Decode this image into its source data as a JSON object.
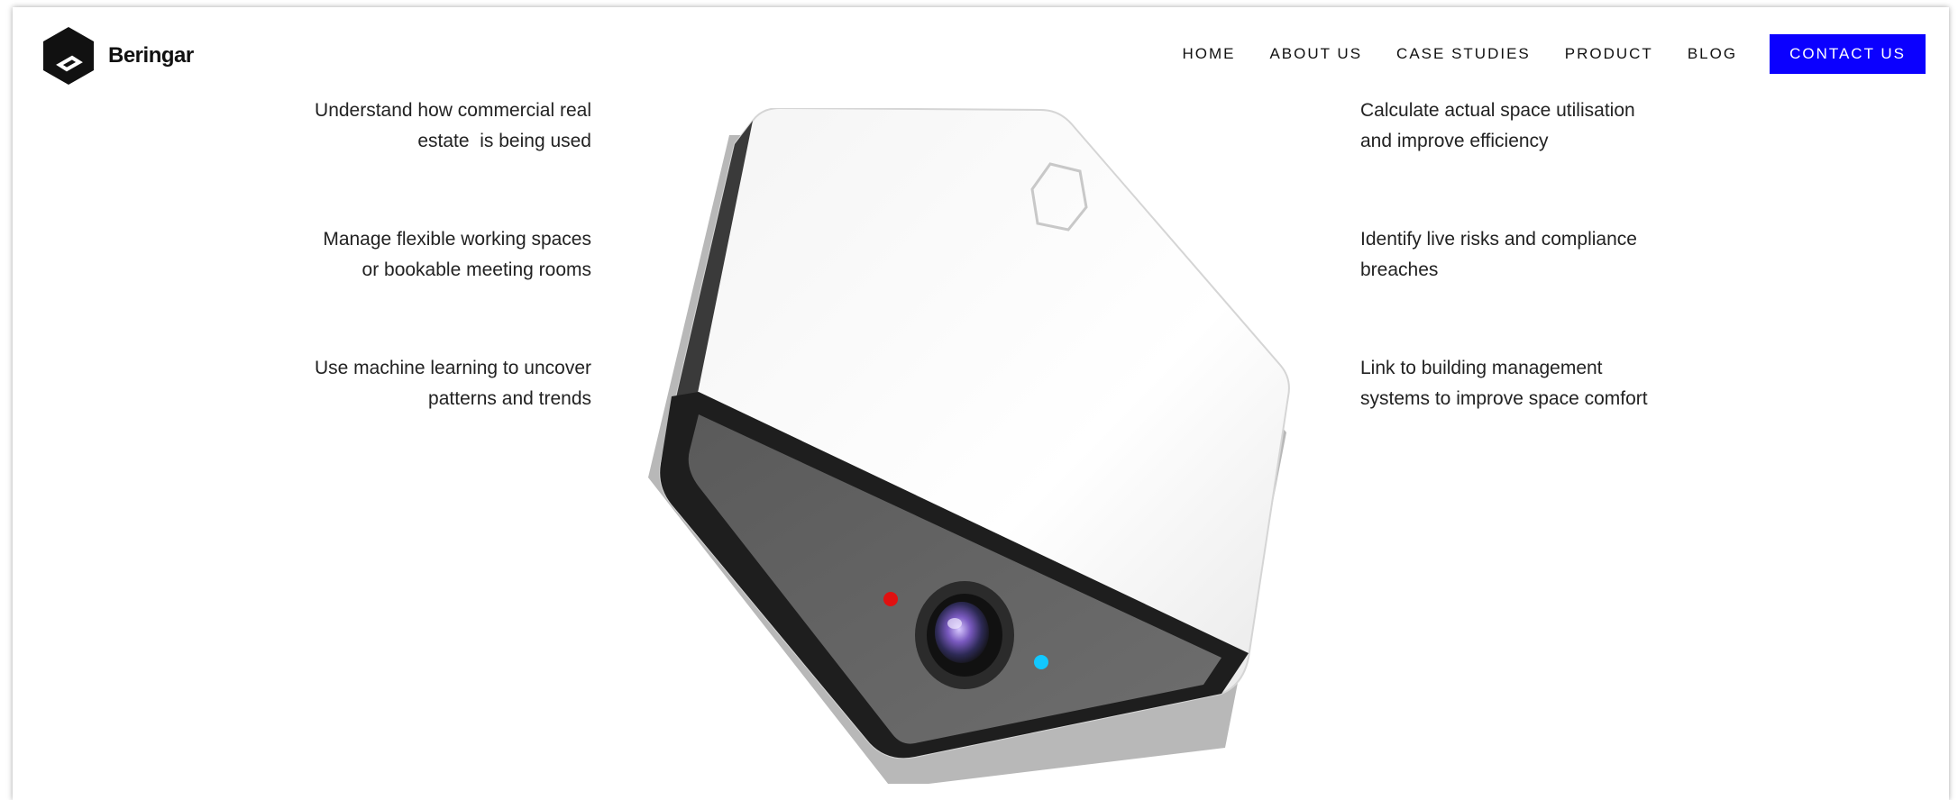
{
  "brand": {
    "name": "Beringar"
  },
  "nav": {
    "items": [
      "HOME",
      "ABOUT US",
      "CASE STUDIES",
      "PRODUCT",
      "BLOG"
    ],
    "cta": "CONTACT US"
  },
  "features": {
    "left": [
      {
        "line1": "Understand how commercial real",
        "line2": "estate  is being used"
      },
      {
        "line1": "Manage flexible working spaces",
        "line2": "or bookable meeting rooms"
      },
      {
        "line1": "Use machine learning to uncover",
        "line2": "patterns and trends"
      }
    ],
    "right": [
      {
        "line1": "Calculate actual space utilisation",
        "line2": "and improve efficiency"
      },
      {
        "line1": "Identify live risks and compliance",
        "line2": "breaches"
      },
      {
        "line1": "Link to building management",
        "line2": "systems to improve space comfort"
      }
    ]
  },
  "colors": {
    "accent": "#0b00ff",
    "text": "#222222",
    "led_red": "#e01010",
    "led_blue": "#12c8ff"
  },
  "icons": {
    "logo": "hexagon-logo-icon",
    "device": "sensor-device-image"
  }
}
